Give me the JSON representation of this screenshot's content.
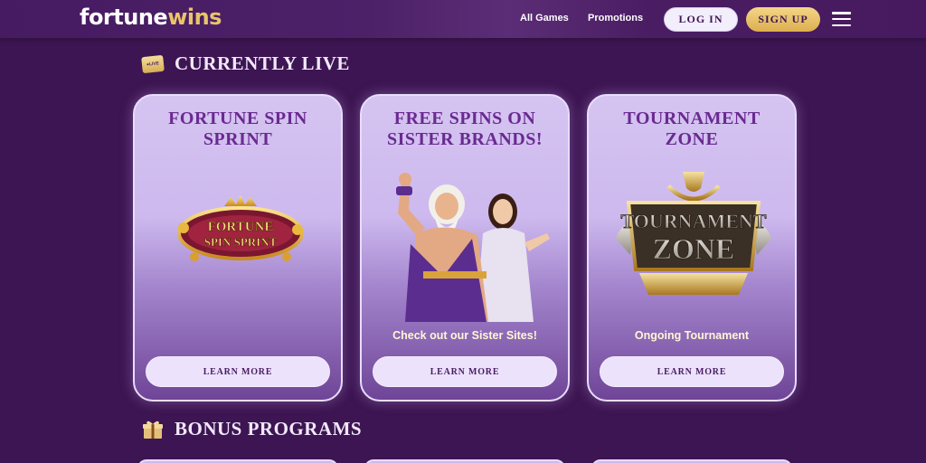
{
  "header": {
    "logo_part1": "fortune",
    "logo_part2": "wins",
    "nav": [
      "All Games",
      "Promotions"
    ],
    "login_label": "LOG IN",
    "signup_label": "SIGN UP",
    "menu_icon": "hamburger-menu-icon"
  },
  "live_section": {
    "icon_text": "●LIVE",
    "title": "CURRENTLY LIVE",
    "cards": [
      {
        "title": "FORTUNE SPIN SPRINT",
        "art_text_line1": "FORTUNE",
        "art_text_line2": "SPIN SPRINT",
        "caption": "",
        "button": "LEARN MORE"
      },
      {
        "title": "FREE SPINS ON SISTER BRANDS!",
        "caption": "Check out our Sister Sites!",
        "button": "LEARN MORE"
      },
      {
        "title": "TOURNAMENT ZONE",
        "art_text_line1": "TOURNAMENT",
        "art_text_line2": "ZONE",
        "caption": "Ongoing Tournament",
        "button": "LEARN MORE"
      }
    ]
  },
  "bonus_section": {
    "title": "BONUS PROGRAMS"
  },
  "colors": {
    "background": "#3d1552",
    "gold": "#e9c46a",
    "card_title": "#6a2a91"
  }
}
